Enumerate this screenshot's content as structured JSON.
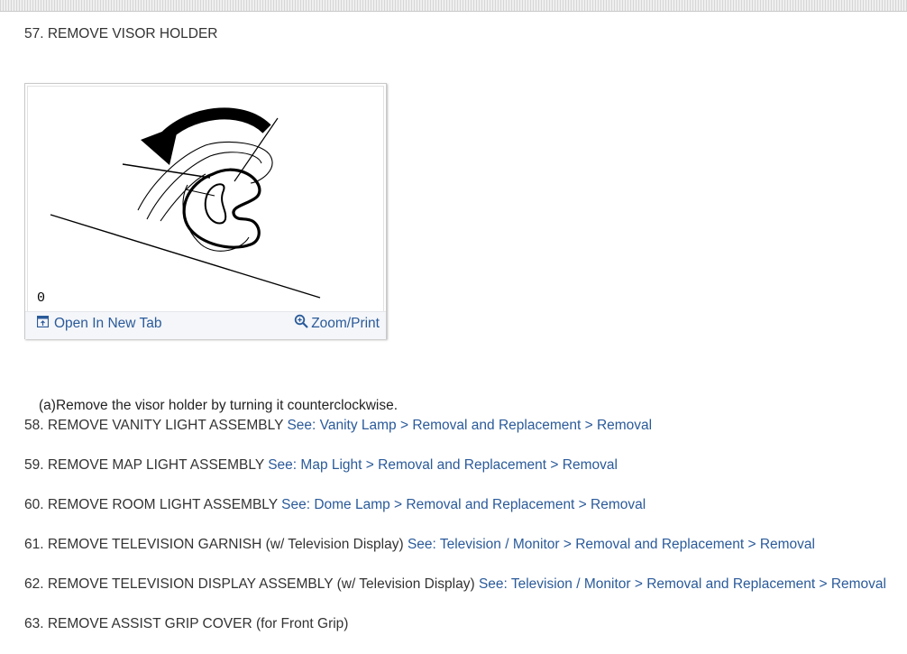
{
  "step57": {
    "title": "57. REMOVE VISOR HOLDER"
  },
  "figure": {
    "code": "0",
    "open_tab_label": "Open In New Tab",
    "zoom_label": "Zoom/Print",
    "open_tab_icon": "open-new-tab-icon",
    "zoom_icon": "magnifier-icon"
  },
  "step57_sub": {
    "text": "(a)Remove the visor holder by turning it counterclockwise."
  },
  "steps": [
    {
      "text": "58. REMOVE VANITY LIGHT ASSEMBLY",
      "link": "See: Vanity Lamp > Removal and Replacement > Removal"
    },
    {
      "text": "59. REMOVE MAP LIGHT ASSEMBLY",
      "link": "See: Map Light > Removal and Replacement > Removal"
    },
    {
      "text": "60. REMOVE ROOM LIGHT ASSEMBLY",
      "link": "See: Dome Lamp > Removal and Replacement > Removal"
    },
    {
      "text": "61. REMOVE TELEVISION GARNISH (w/ Television Display)",
      "link": "See: Television / Monitor > Removal and Replacement > Removal"
    },
    {
      "text": "62. REMOVE TELEVISION DISPLAY ASSEMBLY (w/ Television Display)",
      "link": "See: Television / Monitor > Removal and Replacement > Removal"
    },
    {
      "text": "63. REMOVE ASSIST GRIP COVER (for Front Grip)",
      "link": ""
    }
  ],
  "colors": {
    "link": "#2a5a9a",
    "text": "#333333"
  }
}
